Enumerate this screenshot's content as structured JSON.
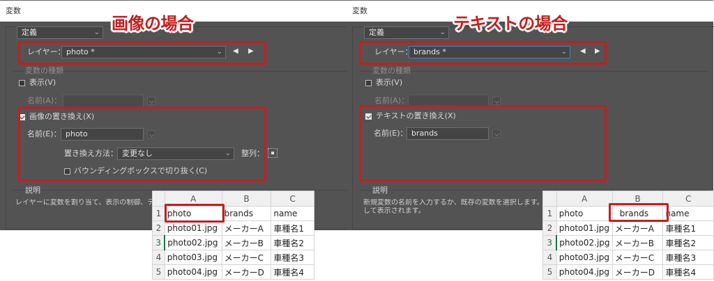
{
  "left": {
    "window_title": "変数",
    "headline": "画像の場合",
    "definition_dropdown": "定義",
    "layer_label": "レイヤー：",
    "layer_value": "photo *",
    "nav_prev": "◀",
    "nav_next": "▶",
    "var_type_group": "変数の種類",
    "visibility_label": "表示(V)",
    "visibility_name_label": "名前(A)：",
    "replace_label": "画像の置き換え(X)",
    "replace_name_label": "名前(E)：",
    "replace_name_value": "photo",
    "method_label": "置き換え方法：",
    "method_value": "変更なし",
    "align_label": "整列：",
    "clip_label": "バウンディングボックスで切り抜く(C)",
    "desc_title": "説明",
    "desc_text": "レイヤーに変数を割り当て、表示の制御、テキ"
  },
  "right": {
    "window_title": "変数",
    "headline": "テキストの場合",
    "definition_dropdown": "定義",
    "layer_label": "レイヤー：",
    "layer_value": "brands *",
    "nav_prev": "◀",
    "nav_next": "▶",
    "var_type_group": "変数の種類",
    "visibility_label": "表示(V)",
    "visibility_name_label": "名前(A)：",
    "replace_label": "テキストの置き換え(X)",
    "replace_name_label": "名前(E)：",
    "replace_name_value": "brands",
    "desc_title": "説明",
    "desc_line1": "新規変数の名前を入力するか、既存の変数を選択します。こ",
    "desc_line2": "して表示されます。"
  },
  "sheet": {
    "columns": [
      "A",
      "B",
      "C"
    ],
    "rows": [
      {
        "num": "1",
        "cells": [
          "photo",
          "brands",
          "name"
        ]
      },
      {
        "num": "2",
        "cells": [
          "photo01.jpg",
          "メーカーA",
          "車種名1"
        ]
      },
      {
        "num": "3",
        "cells": [
          "photo02.jpg",
          "メーカーB",
          "車種名2"
        ]
      },
      {
        "num": "4",
        "cells": [
          "photo03.jpg",
          "メーカーC",
          "車種名3"
        ]
      },
      {
        "num": "5",
        "cells": [
          "photo04.jpg",
          "メーカーD",
          "車種名4"
        ]
      }
    ]
  },
  "colors": {
    "panel_bg": "#535353",
    "highlight_red": "#c41e1e",
    "excel_green": "#217346"
  }
}
